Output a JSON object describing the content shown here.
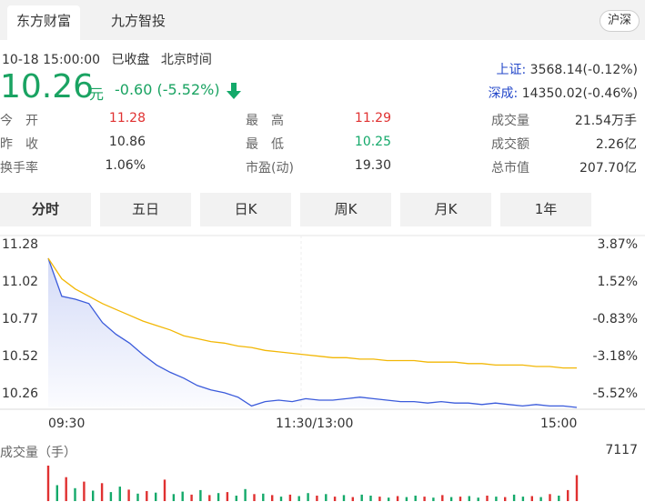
{
  "tabs": [
    "东方财富",
    "九方智投"
  ],
  "market_switch": "沪深",
  "status": {
    "time": "10-18 15:00:00",
    "state": "已收盘",
    "tz": "北京时间"
  },
  "quote": {
    "price": "10.26",
    "unit": "元",
    "change": "-0.60",
    "change_pct": "(-5.52%)"
  },
  "indices": [
    {
      "name": "上证:",
      "value": "3568.14(-0.12%)"
    },
    {
      "name": "深成:",
      "value": "14350.02(-0.46%)"
    }
  ],
  "stats_left": [
    {
      "label": "今　开",
      "value": "11.28",
      "color": "#e03131"
    },
    {
      "label": "昨　收",
      "value": "10.86",
      "color": "#333333"
    },
    {
      "label": "换手率",
      "value": "1.06%",
      "color": "#333333"
    }
  ],
  "stats_mid": [
    {
      "label": "最　高",
      "value": "11.29",
      "color": "#e03131"
    },
    {
      "label": "最　低",
      "value": "10.25",
      "color": "#14a96a"
    },
    {
      "label": "市盈(动)",
      "value": "19.30",
      "color": "#333333"
    }
  ],
  "stats_right": [
    {
      "label": "成交量",
      "value": "21.54万手"
    },
    {
      "label": "成交额",
      "value": "2.26亿"
    },
    {
      "label": "总市值",
      "value": "207.70亿"
    }
  ],
  "periods": [
    "分时",
    "五日",
    "日K",
    "周K",
    "月K",
    "1年"
  ],
  "colors": {
    "price_line": "#3b5bdb",
    "avg_line": "#f2b705",
    "up": "#e03131",
    "down": "#14a96a"
  },
  "chart_data": {
    "type": "line",
    "y_ticks": [
      "11.28",
      "11.02",
      "10.77",
      "10.52",
      "10.26"
    ],
    "y_pct_ticks": [
      "3.87%",
      "1.52%",
      "-0.83%",
      "-3.18%",
      "-5.52%"
    ],
    "ylim": [
      10.26,
      11.28
    ],
    "x_ticks": [
      "09:30",
      "11:30/13:00",
      "15:00"
    ],
    "series": [
      {
        "key": "price",
        "values": [
          11.28,
          11.02,
          11.0,
          10.97,
          10.84,
          10.76,
          10.7,
          10.62,
          10.55,
          10.5,
          10.46,
          10.41,
          10.38,
          10.36,
          10.33,
          10.27,
          10.3,
          10.31,
          10.3,
          10.32,
          10.31,
          10.31,
          10.32,
          10.33,
          10.32,
          10.31,
          10.3,
          10.3,
          10.29,
          10.3,
          10.29,
          10.29,
          10.28,
          10.29,
          10.28,
          10.27,
          10.28,
          10.27,
          10.27,
          10.26
        ]
      },
      {
        "key": "avg",
        "values": [
          11.28,
          11.14,
          11.07,
          11.02,
          10.97,
          10.93,
          10.89,
          10.85,
          10.82,
          10.79,
          10.75,
          10.73,
          10.71,
          10.7,
          10.68,
          10.67,
          10.65,
          10.64,
          10.63,
          10.62,
          10.61,
          10.6,
          10.6,
          10.59,
          10.59,
          10.58,
          10.58,
          10.58,
          10.57,
          10.57,
          10.57,
          10.56,
          10.56,
          10.55,
          10.55,
          10.55,
          10.54,
          10.54,
          10.53,
          10.53
        ]
      }
    ],
    "volume": {
      "label": "成交量（手）",
      "max_label": "7117",
      "values": [
        7117,
        3200,
        4800,
        2600,
        3900,
        2100,
        3600,
        1800,
        2900,
        2300,
        1500,
        2000,
        1700,
        4300,
        1400,
        1900,
        1300,
        2200,
        1200,
        1600,
        1800,
        1100,
        2400,
        1400,
        1500,
        1200,
        900,
        1300,
        1000,
        1600,
        1100,
        1400,
        900,
        1200,
        800,
        1300,
        1100,
        900,
        700,
        1000,
        800,
        1100,
        900,
        700,
        1200,
        800,
        900,
        1000,
        700,
        1100,
        900,
        800,
        1300,
        900,
        1000,
        800,
        1400,
        1100,
        2200,
        5200
      ],
      "up": [
        1,
        0,
        1,
        0,
        1,
        0,
        1,
        0,
        0,
        1,
        0,
        1,
        0,
        1,
        0,
        0,
        1,
        0,
        1,
        0,
        1,
        0,
        0,
        1,
        0,
        1,
        0,
        1,
        0,
        0,
        1,
        0,
        1,
        0,
        1,
        0,
        0,
        1,
        0,
        1,
        0,
        0,
        1,
        0,
        1,
        0,
        1,
        0,
        0,
        1,
        0,
        1,
        0,
        0,
        1,
        0,
        1,
        0,
        1,
        1
      ]
    }
  }
}
